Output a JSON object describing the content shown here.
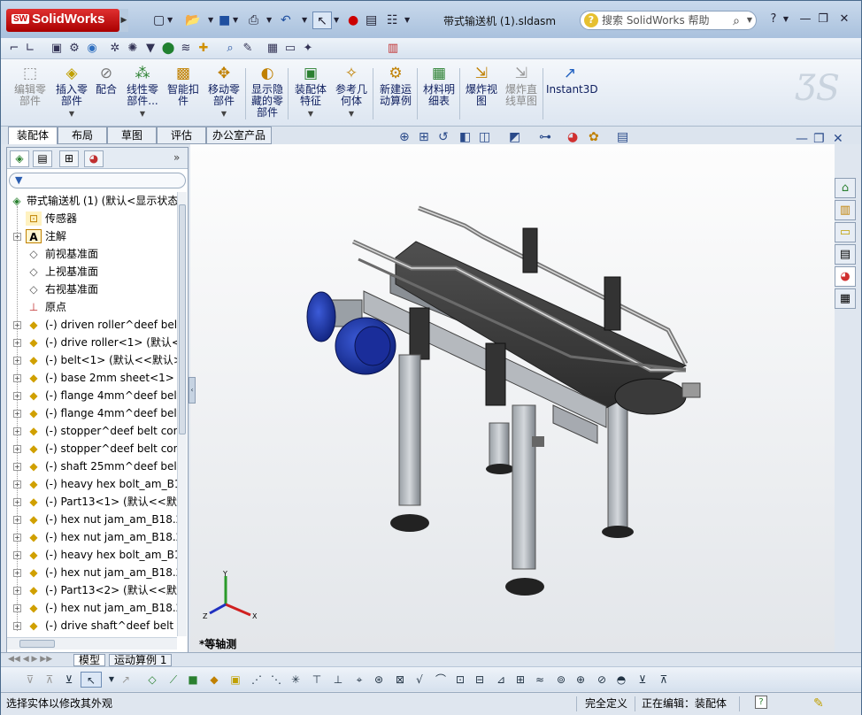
{
  "app": {
    "name": "SolidWorks",
    "logo_badge": "SW"
  },
  "document_title": "带式输送机 (1).sldasm",
  "help_search": {
    "placeholder": "搜索 SolidWorks 帮助"
  },
  "window_controls": {
    "help": "?",
    "minimize": "—",
    "restore": "❐",
    "close": "✕"
  },
  "command_manager": {
    "items": [
      {
        "label": "编辑零\n部件",
        "icon": "edit-component-icon",
        "enabled": false
      },
      {
        "label": "插入零\n部件",
        "icon": "insert-component-icon",
        "enabled": true,
        "has_menu": true
      },
      {
        "label": "配合",
        "icon": "mate-icon",
        "enabled": true
      },
      {
        "label": "线性零\n部件...",
        "icon": "linear-pattern-icon",
        "enabled": true,
        "has_menu": true
      },
      {
        "label": "智能扣\n件",
        "icon": "smart-fasteners-icon",
        "enabled": true
      },
      {
        "label": "移动零\n部件",
        "icon": "move-component-icon",
        "enabled": true,
        "has_menu": true
      },
      {
        "label": "显示隐\n藏的零\n部件",
        "icon": "show-hidden-icon",
        "enabled": true
      },
      {
        "label": "装配体\n特征",
        "icon": "assembly-features-icon",
        "enabled": true,
        "has_menu": true
      },
      {
        "label": "参考几\n何体",
        "icon": "reference-geometry-icon",
        "enabled": true,
        "has_menu": true
      },
      {
        "label": "新建运\n动算例",
        "icon": "new-motion-study-icon",
        "enabled": true
      },
      {
        "label": "材料明\n细表",
        "icon": "bill-of-materials-icon",
        "enabled": true
      },
      {
        "label": "爆炸视\n图",
        "icon": "exploded-view-icon",
        "enabled": true
      },
      {
        "label": "爆炸直\n线草图",
        "icon": "explode-line-sketch-icon",
        "enabled": false
      },
      {
        "label": "Instant3D",
        "icon": "instant3d-icon",
        "enabled": true
      }
    ]
  },
  "cm_tabs": [
    "装配体",
    "布局",
    "草图",
    "评估",
    "办公室产品"
  ],
  "cm_tab_active": 0,
  "feature_tree": {
    "filter_symbol": "▼",
    "nodes": [
      {
        "text": "带式输送机 (1)  (默认<显示状态",
        "type": "root"
      },
      {
        "text": "传感器",
        "type": "sensor"
      },
      {
        "text": "注解",
        "type": "annotation",
        "expandable": true
      },
      {
        "text": "前视基准面",
        "type": "plane"
      },
      {
        "text": "上视基准面",
        "type": "plane"
      },
      {
        "text": "右视基准面",
        "type": "plane"
      },
      {
        "text": "原点",
        "type": "origin"
      },
      {
        "text": "(-) driven roller^deef belt",
        "type": "component",
        "expandable": true
      },
      {
        "text": "(-) drive roller<1>  (默认<",
        "type": "component",
        "expandable": true
      },
      {
        "text": "(-) belt<1>  (默认<<默认>",
        "type": "component",
        "expandable": true
      },
      {
        "text": "(-) base 2mm sheet<1>  (",
        "type": "component",
        "expandable": true
      },
      {
        "text": "(-) flange 4mm^deef belt",
        "type": "component",
        "expandable": true
      },
      {
        "text": "(-) flange 4mm^deef belt",
        "type": "component",
        "expandable": true
      },
      {
        "text": "(-) stopper^deef belt con",
        "type": "component",
        "expandable": true
      },
      {
        "text": "(-) stopper^deef belt con",
        "type": "component",
        "expandable": true
      },
      {
        "text": "(-) shaft 25mm^deef belt",
        "type": "component",
        "expandable": true
      },
      {
        "text": "(-) heavy hex bolt_am_B18",
        "type": "component",
        "expandable": true
      },
      {
        "text": "(-) Part13<1>  (默认<<默认",
        "type": "component",
        "expandable": true
      },
      {
        "text": "(-) hex nut jam_am_B18.2.",
        "type": "component",
        "expandable": true
      },
      {
        "text": "(-) hex nut jam_am_B18.2.",
        "type": "component",
        "expandable": true
      },
      {
        "text": "(-) heavy hex bolt_am_B18",
        "type": "component",
        "expandable": true
      },
      {
        "text": "(-) hex nut jam_am_B18.2.",
        "type": "component",
        "expandable": true
      },
      {
        "text": "(-) Part13<2>  (默认<<默认",
        "type": "component",
        "expandable": true
      },
      {
        "text": "(-) hex nut jam_am_B18.2.",
        "type": "component",
        "expandable": true
      },
      {
        "text": "(-) drive shaft^deef belt co",
        "type": "component",
        "expandable": true
      }
    ]
  },
  "viewport": {
    "view_name": "*等轴测",
    "triad": {
      "x": "X",
      "y": "Y",
      "z": "Z"
    }
  },
  "bottom_tabs": [
    "模型",
    "运动算例 1"
  ],
  "bottom_tab_active": 0,
  "status": {
    "message": "选择实体以修改其外观",
    "definition": "完全定义",
    "editing": "正在编辑：装配体",
    "help": "?"
  },
  "colors": {
    "accent": "#c00000",
    "tree_text": "#000000",
    "window_bg": "#dfe6ef"
  }
}
